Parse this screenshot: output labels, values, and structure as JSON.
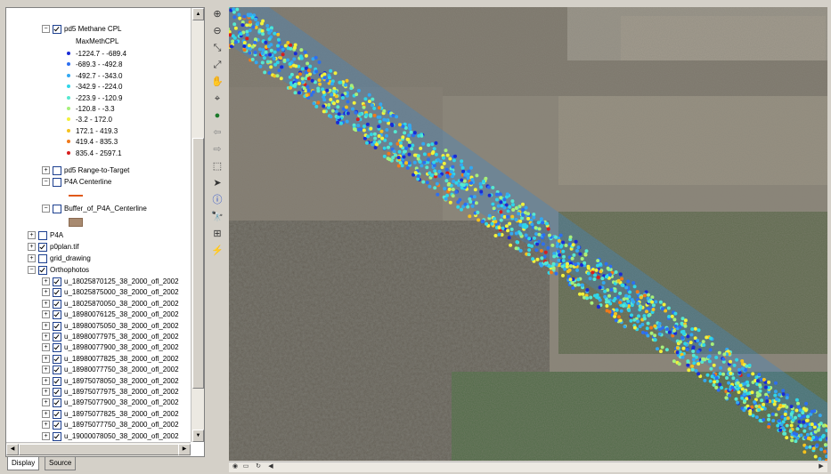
{
  "toc": {
    "layer_methane": "pd5 Methane CPL",
    "field_label": "MaxMethCPL",
    "classes": [
      {
        "label": "-1224.7 - -689.4",
        "color": "#1a2bd6"
      },
      {
        "label": "-689.3 - -492.8",
        "color": "#2d6ff0"
      },
      {
        "label": "-492.7 - -343.0",
        "color": "#33a8f2"
      },
      {
        "label": "-342.9 - -224.0",
        "color": "#30d5e8"
      },
      {
        "label": "-223.9 - -120.9",
        "color": "#56e8d0"
      },
      {
        "label": "-120.8 - -3.3",
        "color": "#a7f07a"
      },
      {
        "label": "-3.2 - 172.0",
        "color": "#f2f23a"
      },
      {
        "label": "172.1 - 419.3",
        "color": "#f5c21e"
      },
      {
        "label": "419.4 - 835.3",
        "color": "#f07a1a"
      },
      {
        "label": "835.4 - 2597.1",
        "color": "#d81e1e"
      }
    ],
    "layer_range": "pd5 Range-to-Target",
    "layer_centerline": "P4A Centerline",
    "layer_buffer": "Buffer_of_P4A_Centerline",
    "layer_p4a": "P4A",
    "layer_p0plan": "p0plan.tif",
    "layer_grid": "grid_drawing",
    "layer_ortho": "Orthophotos",
    "ortho_items": [
      "u_18025870125_38_2000_ofl_2002",
      "u_18025875000_38_2000_ofl_2002",
      "u_18025870050_38_2000_ofl_2002",
      "u_18980076125_38_2000_ofl_2002",
      "u_18980075050_38_2000_ofl_2002",
      "u_18980077975_38_2000_ofl_2002",
      "u_18980077900_38_2000_ofl_2002",
      "u_18980077825_38_2000_ofl_2002",
      "u_18980077750_38_2000_ofl_2002",
      "u_18975078050_38_2000_ofl_2002",
      "u_18975077975_38_2000_ofl_2002",
      "u_18975077900_38_2000_ofl_2002",
      "u_18975077825_38_2000_ofl_2002",
      "u_18975077750_38_2000_ofl_2002",
      "u_19000078050_38_2000_ofl_2002"
    ],
    "tab_display": "Display",
    "tab_source": "Source"
  },
  "colors": {
    "centerline": "#e05a1a",
    "buffer": "#a88a70"
  },
  "tool_icons": [
    "zoom-in-icon",
    "zoom-out-icon",
    "fixed-zoom-in-icon",
    "fixed-zoom-out-icon",
    "pan-icon",
    "full-extent-icon",
    "globe-icon",
    "back-icon",
    "forward-icon",
    "select-features-icon",
    "select-elements-icon",
    "identify-icon",
    "find-icon",
    "measure-icon",
    "hyperlink-icon"
  ]
}
